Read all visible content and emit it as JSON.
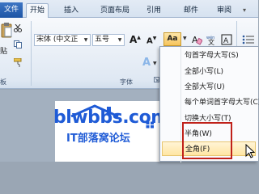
{
  "tabs": {
    "file": "文件",
    "home": "开始",
    "insert": "插入",
    "layout": "页面布局",
    "references": "引用",
    "mailings": "邮件",
    "review": "审阅"
  },
  "clipboard": {
    "paste_label": "贴",
    "group_label": "板"
  },
  "font": {
    "font_name": "宋体 (中文正",
    "font_size": "五号",
    "grow_label": "A",
    "shrink_label": "A",
    "change_case_label": "Aa",
    "group_label": "字体",
    "text_effects_label": "A"
  },
  "watermark": {
    "site": "blwbbs.com",
    "caption": "IT部落窝论坛"
  },
  "case_menu": {
    "items": [
      "句首字母大写(S)",
      "全部小写(L)",
      "全部大写(U)",
      "每个单词首字母大写(C)",
      "切换大小写(T)",
      "半角(W)",
      "全角(F)"
    ],
    "highlighted_index": 6
  },
  "colors": {
    "accent": "#2b579a",
    "highlight_box": "#c0211a",
    "logo_blue": "#1f5bd6"
  }
}
